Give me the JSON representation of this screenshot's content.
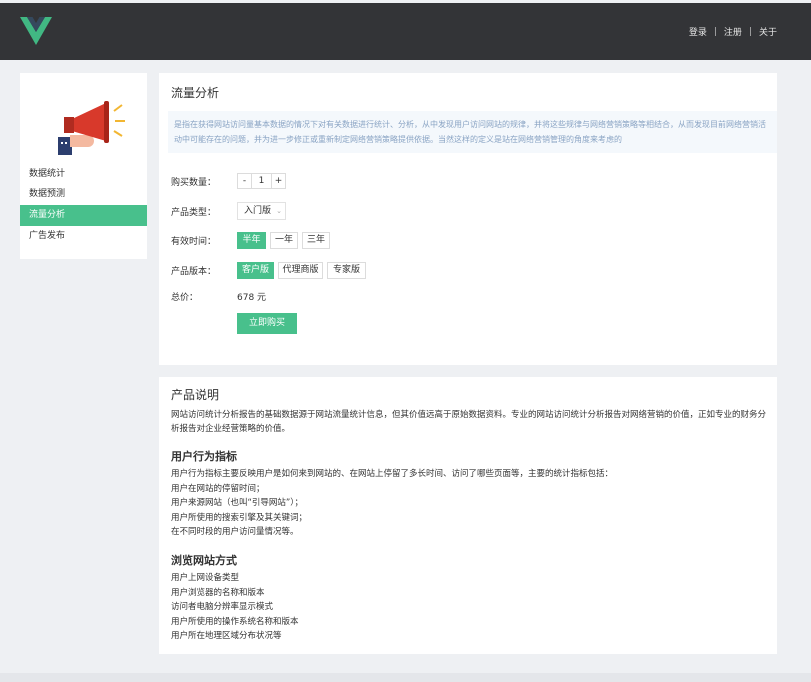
{
  "header": {
    "nav": [
      "登录",
      "注册",
      "关于"
    ],
    "separator": "|"
  },
  "icons": {
    "logo": "vue-logo-icon",
    "sidebar_image": "megaphone-icon",
    "select_arrow": "chevron-down-icon"
  },
  "colors": {
    "accent": "#48c08c",
    "topbar": "#333437",
    "background": "#eef0f3",
    "logo_outer": "#41b883",
    "logo_inner": "#35495e",
    "desc_text": "#8aa4c4"
  },
  "sidebar": {
    "items": [
      {
        "label": "数据统计",
        "active": false
      },
      {
        "label": "数据预测",
        "active": false
      },
      {
        "label": "流量分析",
        "active": true
      },
      {
        "label": "广告发布",
        "active": false
      }
    ]
  },
  "main": {
    "title": "流量分析",
    "description": "是指在获得网站访问量基本数据的情况下对有关数据进行统计、分析，从中发现用户访问网站的规律，并将这些规律与网络营销策略等相结合，从而发现目前网络营销活动中可能存在的问题，并为进一步修正或重新制定网络营销策略提供依据。当然这样的定义是站在网络营销管理的角度来考虑的",
    "form": {
      "quantity_label": "购买数量：",
      "quantity_minus": "-",
      "quantity_value": "1",
      "quantity_plus": "+",
      "type_label": "产品类型：",
      "type_value": "入门版",
      "time_label": "有效时间：",
      "time_options": [
        {
          "label": "半年",
          "active": true
        },
        {
          "label": "一年",
          "active": false
        },
        {
          "label": "三年",
          "active": false
        }
      ],
      "version_label": "产品版本：",
      "version_options": [
        {
          "label": "客户版",
          "active": true
        },
        {
          "label": "代理商版",
          "active": false
        },
        {
          "label": "专家版",
          "active": false
        }
      ],
      "total_label": "总价：",
      "total_value": "678 元",
      "buy_label": "立即购买"
    }
  },
  "details": {
    "title": "产品说明",
    "intro": "网站访问统计分析报告的基础数据源于网站流量统计信息，但其价值远高于原始数据资料。专业的网站访问统计分析报告对网络营销的价值，正如专业的财务分析报告对企业经营策略的价值。",
    "section1": {
      "heading": "用户行为指标",
      "lines": [
        "用户行为指标主要反映用户是如何来到网站的、在网站上停留了多长时间、访问了哪些页面等，主要的统计指标包括：",
        "用户在网站的停留时间；",
        "用户来源网站（也叫“引导网站”）；",
        "用户所使用的搜索引擎及其关键词；",
        "在不同时段的用户访问量情况等。"
      ]
    },
    "section2": {
      "heading": "浏览网站方式",
      "lines": [
        "用户上网设备类型",
        "用户浏览器的名称和版本",
        "访问者电脑分辨率显示模式",
        "用户所使用的操作系统名称和版本",
        "用户所在地理区域分布状况等"
      ]
    }
  }
}
